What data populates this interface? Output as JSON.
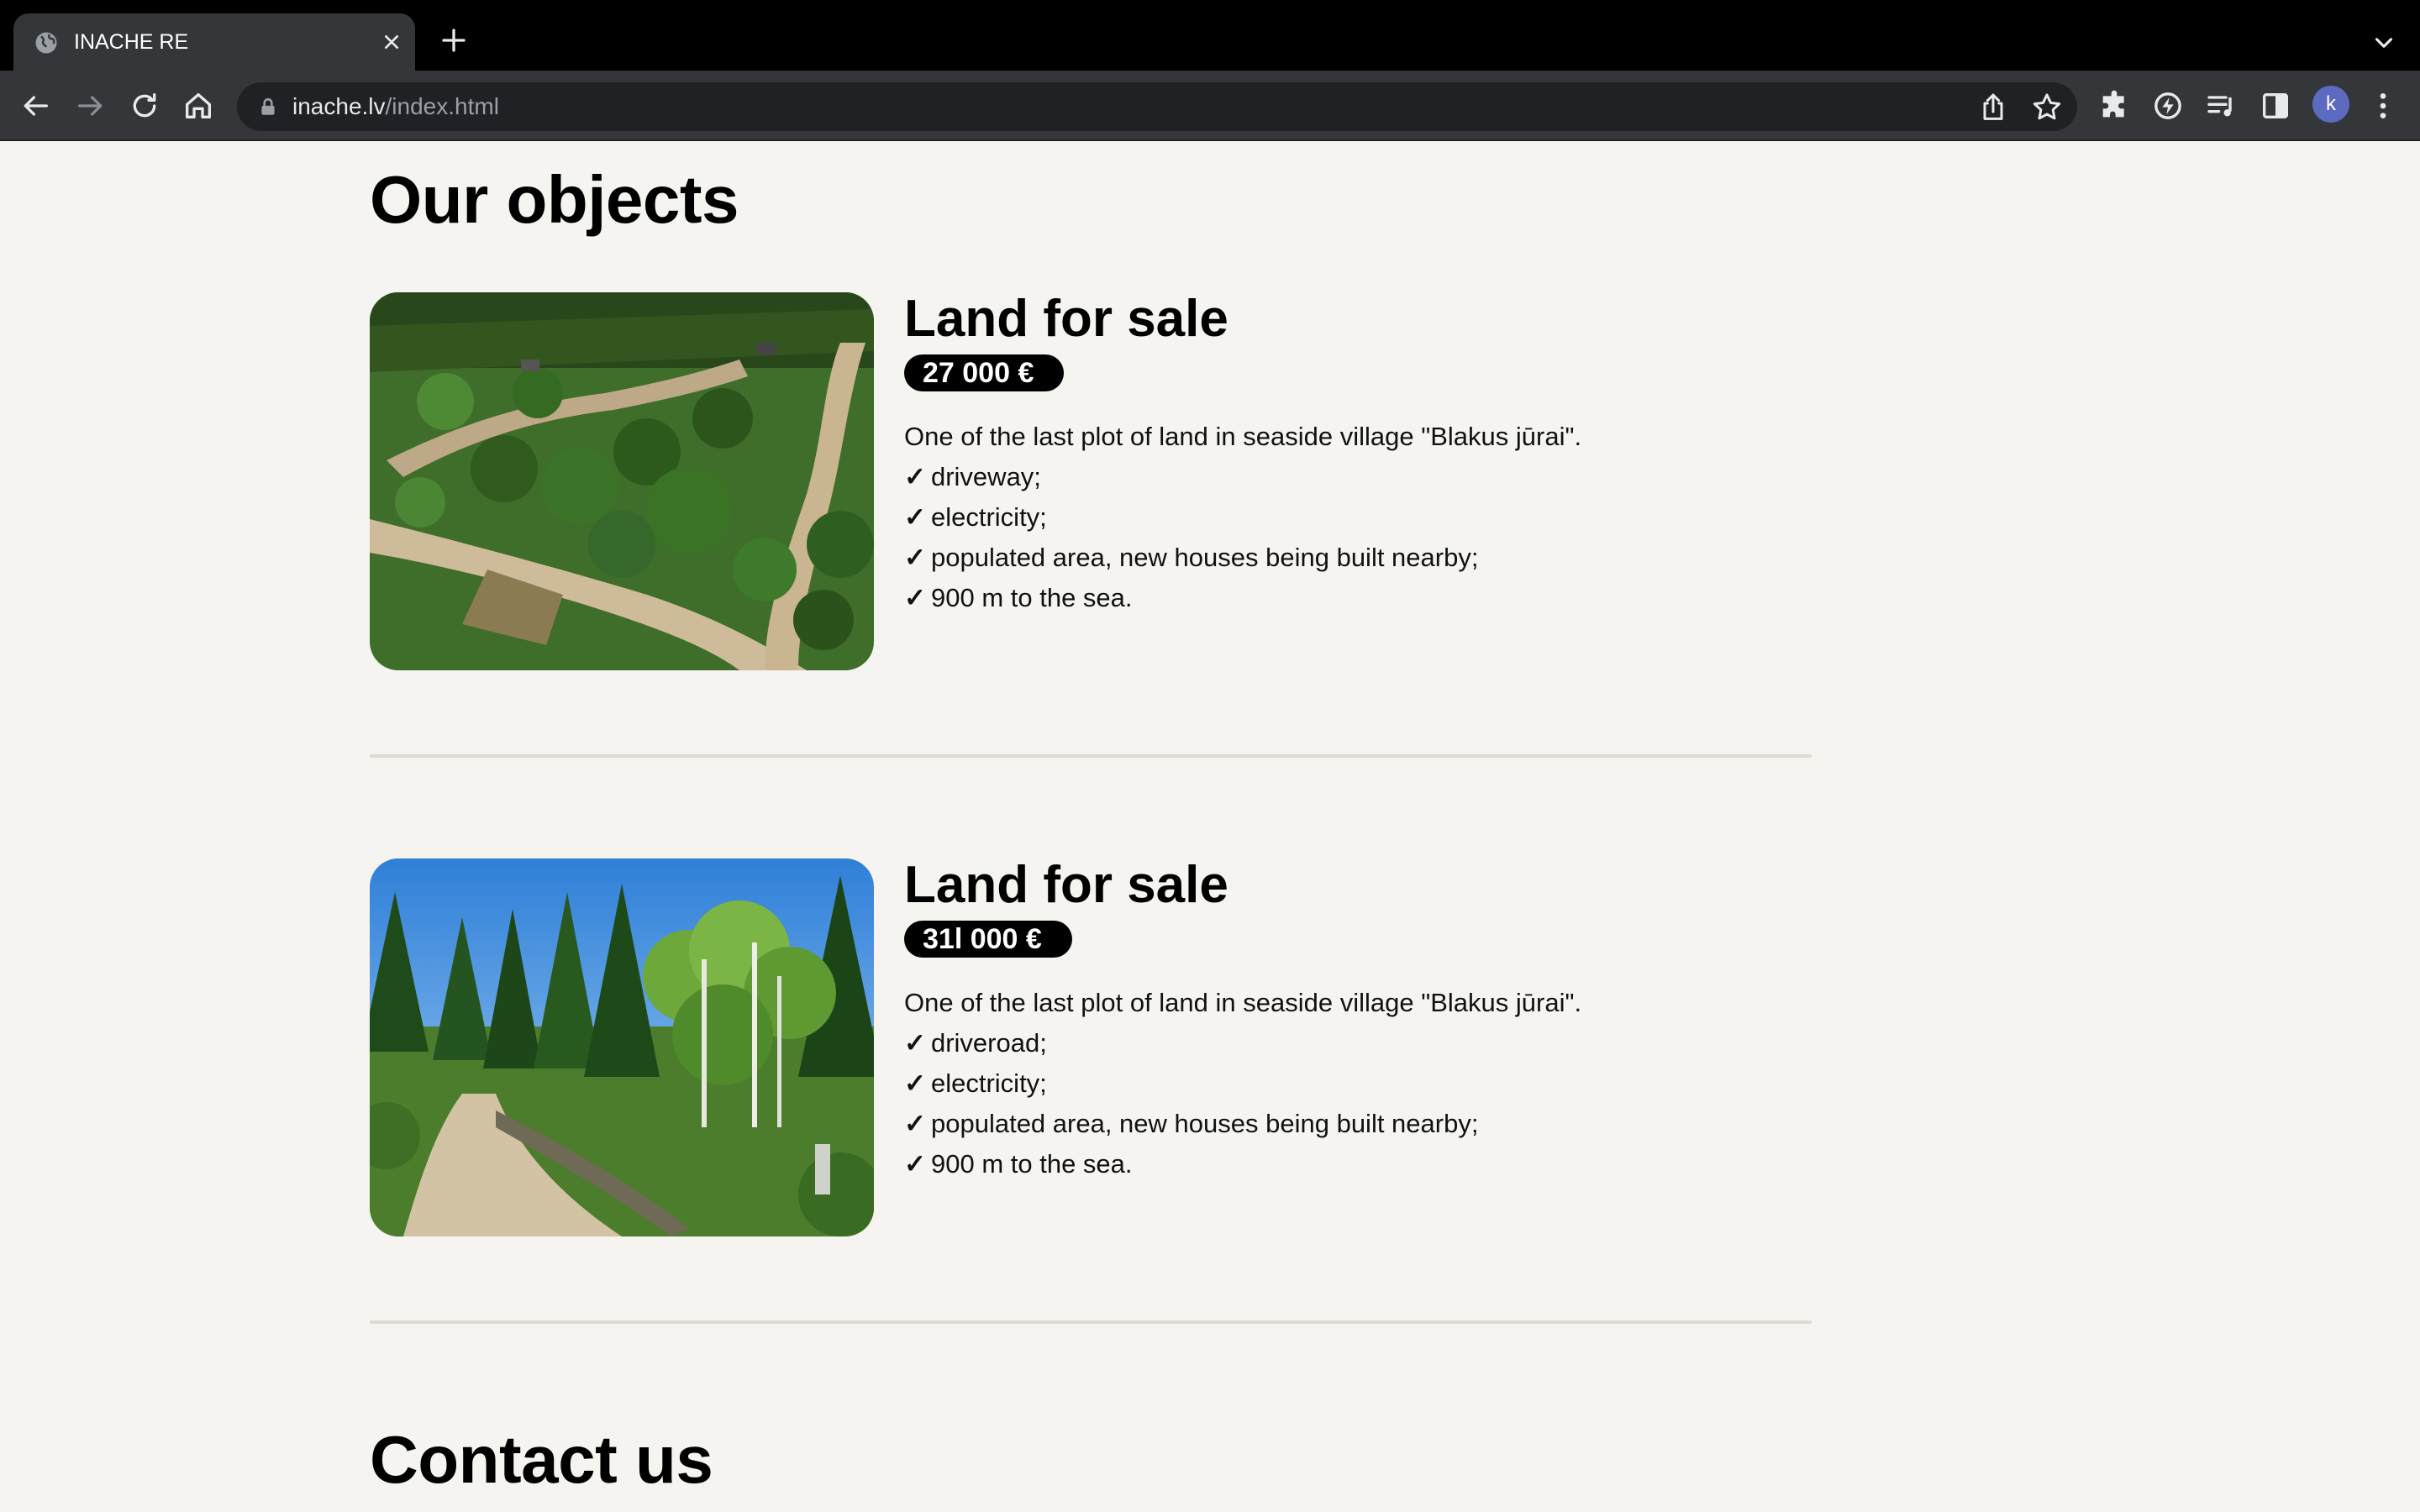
{
  "browser": {
    "tab_title": "INACHE RE",
    "url_host": "inache.lv",
    "url_path": "/index.html",
    "profile_initial": "k"
  },
  "objects_section": {
    "heading": "Our objects",
    "listings": [
      {
        "title": "Land for sale",
        "price": "27 000 €",
        "description": "One of the last plot of land in seaside village \"Blakus jūrai\".",
        "features": [
          "driveway;",
          "electricity;",
          "populated area, new houses being built nearby;",
          "900 m to the sea."
        ]
      },
      {
        "title": "Land for sale",
        "price": "31l 000 €",
        "description": "One of the last plot of land in seaside village \"Blakus jūrai\".",
        "features": [
          "driveroad;",
          "electricity;",
          "populated area, new houses being built nearby;",
          "900 m to the sea."
        ]
      }
    ]
  },
  "contact_section": {
    "heading": "Contact us"
  },
  "check_mark": "✓",
  "colors": {
    "page_background": "#f5f4f0",
    "price_badge": "#000000",
    "divider": "#dddbd6",
    "chrome_dark": "#35363a",
    "avatar": "#5c6bc0"
  }
}
